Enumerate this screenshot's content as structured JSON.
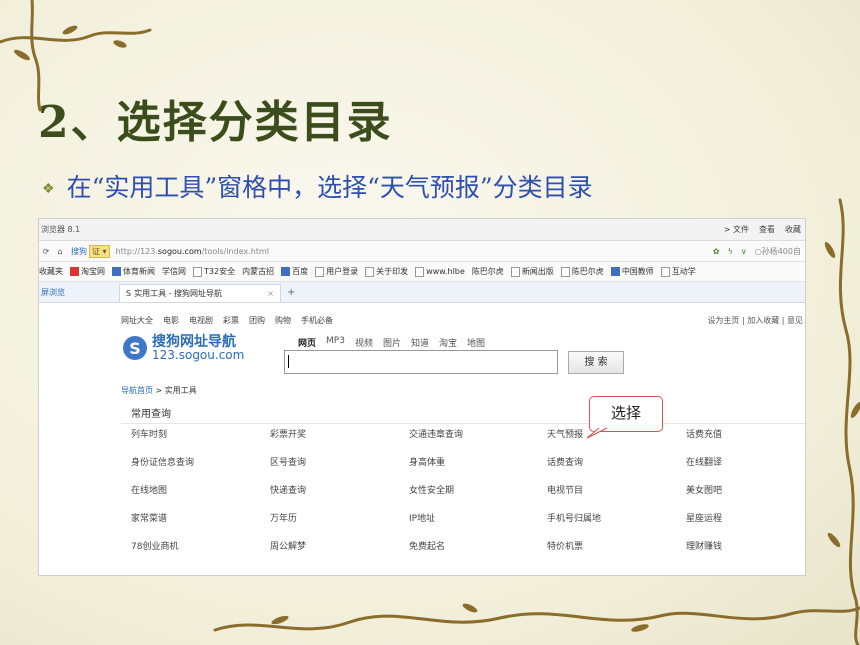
{
  "slide": {
    "title_number": "2",
    "title_text": "、选择分类目录",
    "subtitle": "在“实用工具”窗格中，选择“天气预报”分类目录",
    "bullet_icon": "diamond-bullet-icon"
  },
  "browser": {
    "app_name": "浏览器 8.1",
    "menus": [
      "> 文件",
      "查看",
      "收藏"
    ],
    "address": {
      "search_label": "搜狗",
      "cert_label": "证 ▾",
      "url_prefix": "http://123.",
      "url_domain": "sogou.com",
      "url_path": "/tools/index.html",
      "right_user": "孙杨400自"
    },
    "favorites": [
      "收藏夹",
      "淘宝网",
      "体育新闻",
      "学信网",
      "T32安全",
      "内蒙古招",
      "百度",
      "用户登录",
      "关于印发",
      "www.hlbe",
      "陈巴尔虎",
      "新闻出版",
      "陈巴尔虎",
      "中国教师",
      "互动学"
    ],
    "side_label": "屏浏览",
    "tab": {
      "title": "实用工具 - 搜狗网址导航",
      "close": "×",
      "new_tab": "+"
    },
    "page": {
      "top_links": [
        "网址大全",
        "电影",
        "电视剧",
        "彩票",
        "团购",
        "购物",
        "手机必备"
      ],
      "top_right": "设为主页 | 加入收藏 | 意见",
      "logo_title": "搜狗网址导航",
      "logo_url": "123.sogou.com",
      "search_tabs": [
        "网页",
        "MP3",
        "视频",
        "图片",
        "知道",
        "淘宝",
        "地图"
      ],
      "search_button": "搜 索",
      "breadcrumb": [
        "导航首页",
        "> 实用工具"
      ],
      "section_title": "常用查询",
      "rows": [
        [
          "列车时刻",
          "彩票开奖",
          "交通违章查询",
          "天气预报",
          "话费充值"
        ],
        [
          "身份证信息查询",
          "区号查询",
          "身高体重",
          "话费查询",
          "在线翻译"
        ],
        [
          "在线地图",
          "快递查询",
          "女性安全期",
          "电视节目",
          "美女图吧"
        ],
        [
          "家常菜谱",
          "万年历",
          "IP地址",
          "手机号归属地",
          "星座运程"
        ],
        [
          "78创业商机",
          "周公解梦",
          "免费起名",
          "特价机票",
          "理财赚钱"
        ]
      ]
    }
  },
  "callout": {
    "text": "选择"
  },
  "colors": {
    "title": "#3a4d1a",
    "subtitle": "#2f4fb0",
    "link_blue": "#2a6db8",
    "callout_border": "#e05050"
  }
}
